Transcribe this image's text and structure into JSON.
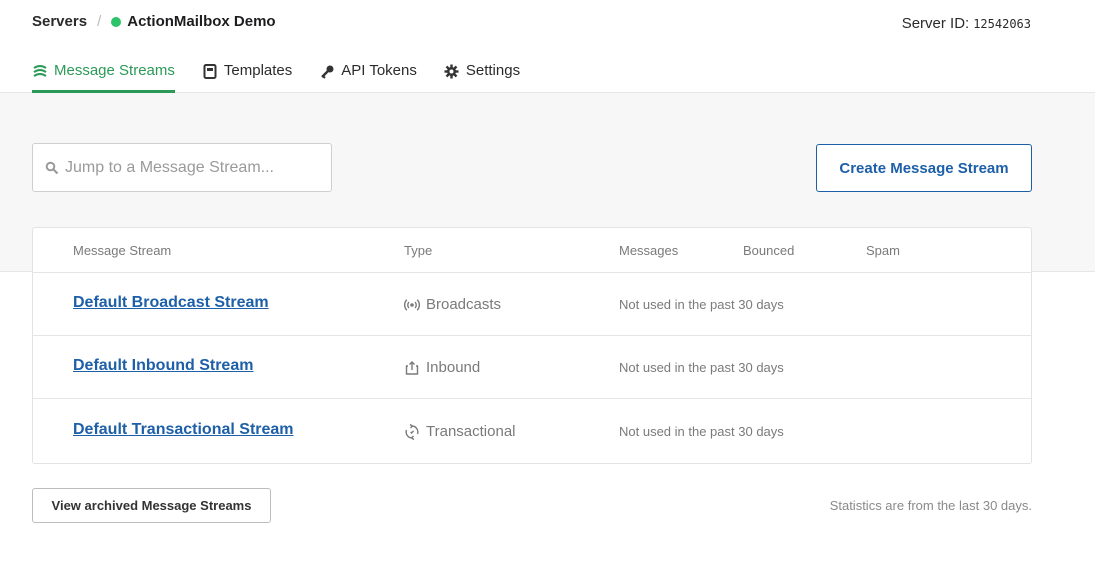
{
  "breadcrumb": {
    "root": "Servers",
    "separator": "/",
    "server_name": "ActionMailbox Demo",
    "status_color": "#2bc46a"
  },
  "server_id": {
    "label": "Server ID:",
    "value": "12542063"
  },
  "tabs": [
    {
      "label": "Message Streams",
      "icon": "streams-icon",
      "active": true
    },
    {
      "label": "Templates",
      "icon": "template-icon",
      "active": false
    },
    {
      "label": "API Tokens",
      "icon": "key-icon",
      "active": false
    },
    {
      "label": "Settings",
      "icon": "gear-icon",
      "active": false
    }
  ],
  "search": {
    "placeholder": "Jump to a Message Stream..."
  },
  "create_button": "Create Message Stream",
  "table": {
    "headers": [
      "Message Stream",
      "Type",
      "Messages",
      "Bounced",
      "Spam"
    ],
    "rows": [
      {
        "name": "Default Broadcast Stream",
        "type": "Broadcasts",
        "type_icon": "broadcast-icon",
        "usage": "Not used in the past 30 days"
      },
      {
        "name": "Default Inbound Stream",
        "type": "Inbound",
        "type_icon": "inbound-icon",
        "usage": "Not used in the past 30 days"
      },
      {
        "name": "Default Transactional Stream",
        "type": "Transactional",
        "type_icon": "transactional-icon",
        "usage": "Not used in the past 30 days"
      }
    ]
  },
  "archived_button": "View archived Message Streams",
  "stats_note": "Statistics are from the last 30 days.",
  "colors": {
    "accent_green": "#2b9a58",
    "link_blue": "#1d5fa8",
    "band_gray": "#f7f7f7"
  }
}
